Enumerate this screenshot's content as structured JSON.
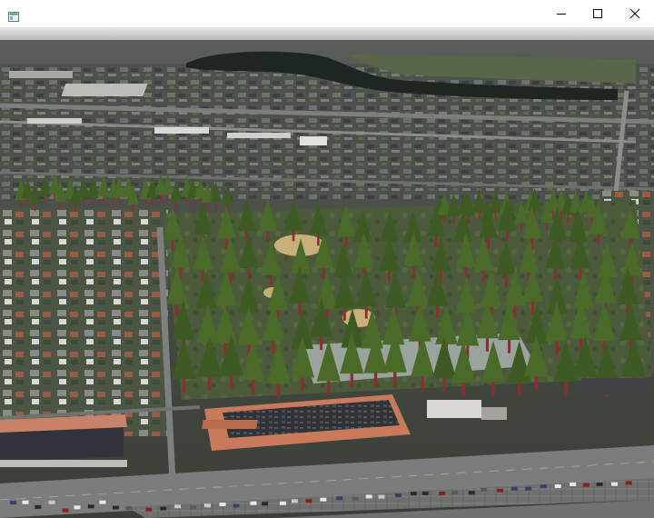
{
  "window": {
    "title": "",
    "icon": "app-window-icon",
    "controls": [
      {
        "name": "minimize-button",
        "icon": "minimize-icon"
      },
      {
        "name": "maximize-button",
        "icon": "maximize-icon"
      },
      {
        "name": "close-button",
        "icon": "close-icon"
      }
    ]
  },
  "scene": {
    "type": "3d-aerial-terrain-view",
    "colors": {
      "sky": "#cfcfcf",
      "terrain": "#4a4f46",
      "road": "#7c7f7c",
      "tree_canopy": "#3c5a22",
      "tree_trunk": "#8a2f2e",
      "roof_brick": "#c97a5a",
      "roof_dark": "#2b2d31",
      "pond": "#202a22"
    }
  }
}
